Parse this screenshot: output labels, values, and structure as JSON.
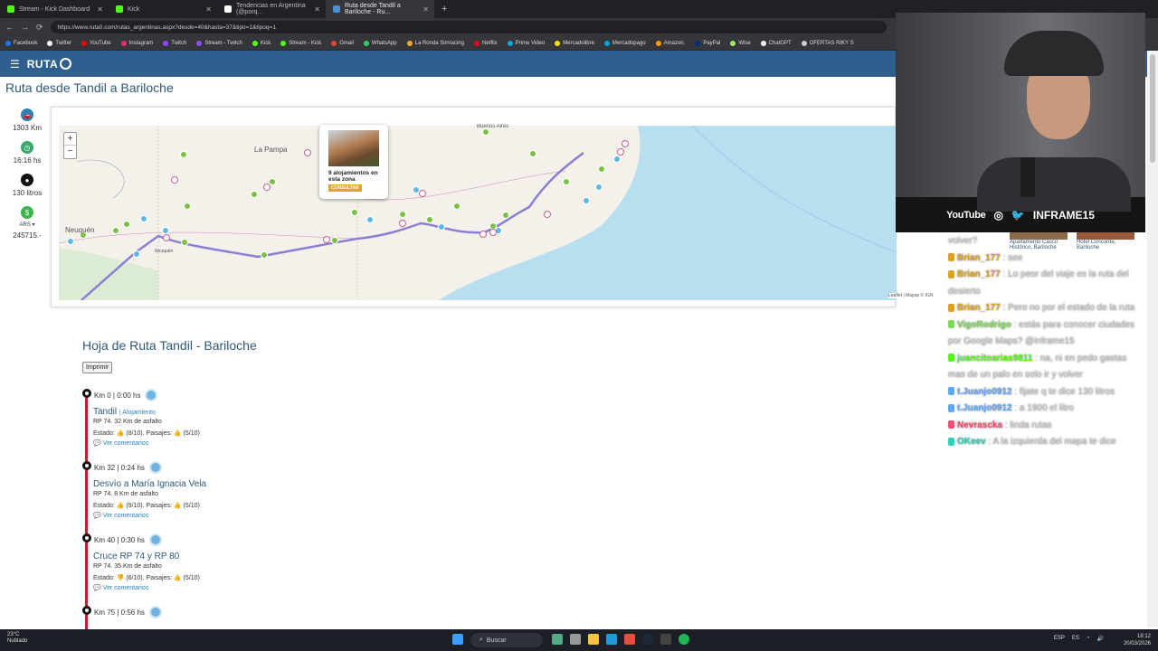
{
  "browser": {
    "tabs": [
      {
        "label": "Stream - Kick Dashboard",
        "color": "#53fc18"
      },
      {
        "label": "Kick",
        "color": "#53fc18"
      },
      {
        "label": "Tendencias en Argentina (@porq...",
        "color": "#ffffff"
      },
      {
        "label": "Ruta desde Tandil a Bariloche - Ru...",
        "color": "#4a90d9"
      }
    ],
    "url": "https://www.ruta0.com/rutas_argentinas.aspx?desde=40&hasta=37&tipo=1&tipoq=1",
    "bookmarks": [
      {
        "label": "Facebook",
        "color": "#1877f2"
      },
      {
        "label": "Twitter",
        "color": "#ffffff"
      },
      {
        "label": "YouTube",
        "color": "#ff0000"
      },
      {
        "label": "Instagram",
        "color": "#e1306c"
      },
      {
        "label": "Twitch",
        "color": "#9146ff"
      },
      {
        "label": "Stream - Twitch",
        "color": "#9146ff"
      },
      {
        "label": "Kick",
        "color": "#53fc18"
      },
      {
        "label": "Stream - Kick",
        "color": "#53fc18"
      },
      {
        "label": "Gmail",
        "color": "#ea4335"
      },
      {
        "label": "WhatsApp",
        "color": "#25d366"
      },
      {
        "label": "La Ronda Simracing",
        "color": "#f5a623"
      },
      {
        "label": "Netflix",
        "color": "#e50914"
      },
      {
        "label": "Prime Video",
        "color": "#00a8e1"
      },
      {
        "label": "Mercadolibre",
        "color": "#ffe600"
      },
      {
        "label": "Mercadopago",
        "color": "#009ee3"
      },
      {
        "label": "Amazon.",
        "color": "#ff9900"
      },
      {
        "label": "PayPal",
        "color": "#003087"
      },
      {
        "label": "Wise",
        "color": "#9fe870"
      },
      {
        "label": "ChatGPT",
        "color": "#ffffff"
      },
      {
        "label": "OFERTAS RIKY S",
        "color": "#cccccc"
      }
    ]
  },
  "site": {
    "logo": "RUTA",
    "title": "Ruta desde Tandil a Bariloche"
  },
  "stats": [
    {
      "value": "1303 Km",
      "color": "#2c7fb8",
      "glyph": "🚗"
    },
    {
      "value": "16:16 hs",
      "color": "#3aa76d",
      "glyph": "◷"
    },
    {
      "value": "130 litros",
      "color": "#111111",
      "glyph": "●"
    },
    {
      "value": "245715.-",
      "currency": "ARS",
      "color": "#3cb54a",
      "glyph": "$"
    }
  ],
  "map": {
    "labels": {
      "lapampa": "La Pampa",
      "neuquen": "Neuquén",
      "neuquen2": "Neuquén",
      "buenosaires": "Buenos Aires"
    },
    "popup": {
      "text": "9 alojamientos en esta zona",
      "button": "CONSULTAR"
    },
    "attribution": "Leaflet | Mapas © IGN"
  },
  "hoja": {
    "title": "Hoja de Ruta Tandil - Bariloche",
    "print": "Imprimir",
    "waypoints": [
      {
        "km": "Km 0 | 0:00 hs",
        "name": "Tandil",
        "tag": "| Alojamiento",
        "road": "RP 74. 32 Km de asfalto",
        "estado": "Estado: 👍 (8/10). Paisajes: 👍 (5/10)",
        "link": "Ver comentarios"
      },
      {
        "km": "Km 32 | 0:24 hs",
        "name": "Desvío a María Ignacia Vela",
        "tag": "",
        "road": "RP 74. 8 Km de asfalto",
        "estado": "Estado: 👍 (9/10). Paisajes: 👍 (5/10)",
        "link": "Ver comentarios"
      },
      {
        "km": "Km 40 | 0:30 hs",
        "name": "Cruce RP 74 y RP 80",
        "tag": "",
        "road": "RP 74. 35 Km de asfalto",
        "estado": "Estado: 👎 (6/10). Paisajes: 👍 (5/10)",
        "link": "Ver comentarios"
      },
      {
        "km": "Km 75 | 0:56 hs",
        "name": "",
        "tag": "",
        "road": "",
        "estado": "",
        "link": ""
      }
    ]
  },
  "hotels": [
    {
      "name": "Apartamento Casco Histórico, Bariloche"
    },
    {
      "name": "Hotel Concorde, Bariloche"
    }
  ],
  "stream": {
    "socials": "YouTube",
    "handle": "INFRAME15"
  },
  "chat": [
    {
      "user": "",
      "color": "#c5c5c5",
      "text": "volver?"
    },
    {
      "user": "Brian_177",
      "color": "#e0a020",
      "text": ": see"
    },
    {
      "user": "Brian_177",
      "color": "#e0a020",
      "text": ": Lo peor del viaje es la ruta del desierto"
    },
    {
      "user": "Brian_177",
      "color": "#e0a020",
      "text": ": Pero no por el estado de la ruta"
    },
    {
      "user": "VigoRodrigo",
      "color": "#7ed957",
      "text": ": estás para conocer ciudades por Google Maps? @inframe15"
    },
    {
      "user": "juancitoarias9811",
      "color": "#53fc18",
      "text": ": na, ni en pedo gastas mas de un palo en solo ir y volver"
    },
    {
      "user": "t.Juanjo0912",
      "color": "#5fa8ff",
      "text": ": fijate q te dice 130 litros"
    },
    {
      "user": "t.Juanjo0912",
      "color": "#5fa8ff",
      "text": ": a 1900 el litro"
    },
    {
      "user": "Nevrascka",
      "color": "#ff4d6d",
      "text": ": linda rutas"
    },
    {
      "user": "OKeev",
      "color": "#2ed3b7",
      "text": ": A la izquierda del mapa te dice"
    }
  ],
  "taskbar": {
    "weather_temp": "23°C",
    "weather_text": "Nublado",
    "search": "Buscar",
    "lang": "ESP",
    "lang2": "ES",
    "time": "18:12",
    "date": "20/03/2026"
  }
}
